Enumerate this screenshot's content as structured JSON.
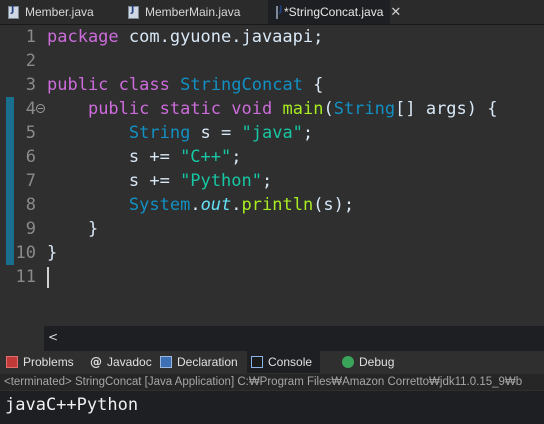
{
  "editor_tabs": [
    {
      "label": "Member.java"
    },
    {
      "label": "MemberMain.java"
    },
    {
      "label": "*StringConcat.java",
      "active": true
    }
  ],
  "code_lines": [
    {
      "num": "1",
      "tokens": [
        [
          "kw",
          "package"
        ],
        [
          "txt",
          " com.gyuone.javaapi;"
        ]
      ]
    },
    {
      "num": "2",
      "tokens": []
    },
    {
      "num": "3",
      "tokens": [
        [
          "kw",
          "public"
        ],
        [
          "txt",
          " "
        ],
        [
          "kw",
          "class"
        ],
        [
          "txt",
          " "
        ],
        [
          "cls",
          "StringConcat"
        ],
        [
          "txt",
          " {"
        ]
      ]
    },
    {
      "num": "4",
      "fold": true,
      "tokens": [
        [
          "txt",
          "    "
        ],
        [
          "kw",
          "public"
        ],
        [
          "txt",
          " "
        ],
        [
          "kw",
          "static"
        ],
        [
          "txt",
          " "
        ],
        [
          "kw",
          "void"
        ],
        [
          "txt",
          " "
        ],
        [
          "mth",
          "main"
        ],
        [
          "txt",
          "("
        ],
        [
          "cls",
          "String"
        ],
        [
          "txt",
          "[] args) {"
        ]
      ]
    },
    {
      "num": "5",
      "tokens": [
        [
          "txt",
          "        "
        ],
        [
          "cls",
          "String"
        ],
        [
          "txt",
          " s = "
        ],
        [
          "str",
          "\"java\""
        ],
        [
          "txt",
          ";"
        ]
      ]
    },
    {
      "num": "6",
      "tokens": [
        [
          "txt",
          "        s += "
        ],
        [
          "str",
          "\"C++\""
        ],
        [
          "txt",
          ";"
        ]
      ]
    },
    {
      "num": "7",
      "tokens": [
        [
          "txt",
          "        s += "
        ],
        [
          "str",
          "\"Python\""
        ],
        [
          "txt",
          ";"
        ]
      ]
    },
    {
      "num": "8",
      "tokens": [
        [
          "txt",
          "        "
        ],
        [
          "cls",
          "System"
        ],
        [
          "txt",
          "."
        ],
        [
          "fld",
          "out"
        ],
        [
          "txt",
          "."
        ],
        [
          "mth",
          "println"
        ],
        [
          "txt",
          "(s);"
        ]
      ]
    },
    {
      "num": "9",
      "tokens": [
        [
          "txt",
          "    }"
        ]
      ]
    },
    {
      "num": "10",
      "tokens": [
        [
          "txt",
          "}"
        ]
      ]
    },
    {
      "num": "11",
      "tokens": []
    }
  ],
  "hscroll_arrow": "<",
  "view_tabs": [
    {
      "label": "Problems",
      "icon": "problems-icon"
    },
    {
      "label": "Javadoc",
      "icon": "javadoc-icon",
      "glyph": "@"
    },
    {
      "label": "Declaration",
      "icon": "declaration-icon"
    },
    {
      "label": "Console",
      "icon": "console-icon",
      "active": true
    },
    {
      "label": "Debug",
      "icon": "debug-icon"
    }
  ],
  "console": {
    "status": "<terminated> StringConcat [Java Application] C:₩Program Files₩Amazon Corretto₩jdk11.0.15_9₩b",
    "output": "javaC++Python"
  },
  "colors": {
    "keyword": "#cc6cdb",
    "class": "#1290c3",
    "string": "#17c6a3",
    "method": "#a7ec21",
    "field": "#66e1f8",
    "text": "#d9e8f7",
    "editor_bg": "#2f2f2f"
  }
}
